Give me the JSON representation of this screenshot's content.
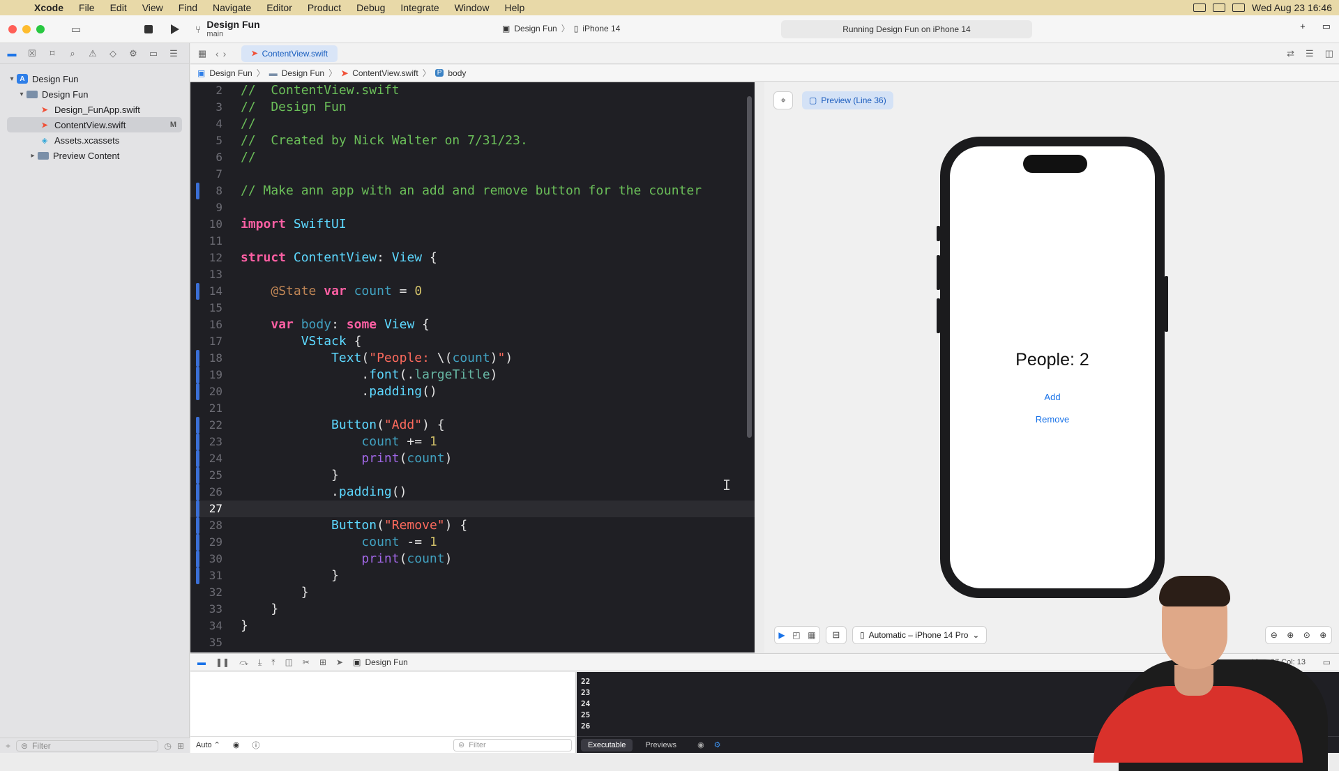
{
  "menubar": {
    "app_name": "Xcode",
    "menus": [
      "File",
      "Edit",
      "View",
      "Find",
      "Navigate",
      "Editor",
      "Product",
      "Debug",
      "Integrate",
      "Window",
      "Help"
    ],
    "datetime": "Wed Aug 23  16:46"
  },
  "toolbar": {
    "project_name": "Design Fun",
    "branch": "main",
    "scheme": "Design Fun",
    "destination": "iPhone 14",
    "status": "Running Design Fun on iPhone 14"
  },
  "navigator": {
    "items": [
      {
        "label": "Design Fun",
        "kind": "project",
        "level": 0
      },
      {
        "label": "Design Fun",
        "kind": "folder",
        "level": 1
      },
      {
        "label": "Design_FunApp.swift",
        "kind": "swift",
        "level": 2
      },
      {
        "label": "ContentView.swift",
        "kind": "swift",
        "level": 2,
        "badge": "M",
        "selected": true
      },
      {
        "label": "Assets.xcassets",
        "kind": "assets",
        "level": 2
      },
      {
        "label": "Preview Content",
        "kind": "folder",
        "level": 2
      }
    ],
    "filter_placeholder": "Filter"
  },
  "editor": {
    "tab": "ContentView.swift",
    "breadcrumbs": [
      "Design Fun",
      "Design Fun",
      "ContentView.swift",
      "body"
    ],
    "current_line": 27,
    "lines": [
      {
        "n": "2",
        "t": "//  ContentView.swift"
      },
      {
        "n": "3",
        "t": "//  Design Fun"
      },
      {
        "n": "4",
        "t": "//"
      },
      {
        "n": "5",
        "t": "//  Created by Nick Walter on 7/31/23."
      },
      {
        "n": "6",
        "t": "//"
      },
      {
        "n": "7",
        "t": ""
      },
      {
        "n": "8",
        "t": "// Make ann app with an add and remove button for the counter"
      },
      {
        "n": "9",
        "t": ""
      },
      {
        "n": "10",
        "t": "import SwiftUI"
      },
      {
        "n": "11",
        "t": ""
      },
      {
        "n": "12",
        "t": "struct ContentView: View {"
      },
      {
        "n": "13",
        "t": ""
      },
      {
        "n": "14",
        "t": "    @State var count = 0"
      },
      {
        "n": "15",
        "t": ""
      },
      {
        "n": "16",
        "t": "    var body: some View {"
      },
      {
        "n": "17",
        "t": "        VStack {"
      },
      {
        "n": "18",
        "t": "            Text(\"People: \\(count)\")"
      },
      {
        "n": "19",
        "t": "                .font(.largeTitle)"
      },
      {
        "n": "20",
        "t": "                .padding()"
      },
      {
        "n": "21",
        "t": ""
      },
      {
        "n": "22",
        "t": "            Button(\"Add\") {"
      },
      {
        "n": "23",
        "t": "                count += 1"
      },
      {
        "n": "24",
        "t": "                print(count)"
      },
      {
        "n": "25",
        "t": "            }"
      },
      {
        "n": "26",
        "t": "            .padding()"
      },
      {
        "n": "27",
        "t": ""
      },
      {
        "n": "28",
        "t": "            Button(\"Remove\") {"
      },
      {
        "n": "29",
        "t": "                count -= 1"
      },
      {
        "n": "30",
        "t": "                print(count)"
      },
      {
        "n": "31",
        "t": "            }"
      },
      {
        "n": "32",
        "t": "        }"
      },
      {
        "n": "33",
        "t": "    }"
      },
      {
        "n": "34",
        "t": "}"
      },
      {
        "n": "35",
        "t": ""
      }
    ]
  },
  "preview": {
    "label": "Preview (Line 36)",
    "people_text": "People: 2",
    "add_label": "Add",
    "remove_label": "Remove",
    "device": "Automatic – iPhone 14 Pro"
  },
  "debugbar": {
    "scheme": "Design Fun",
    "line_col": "Line: 27  Col: 13"
  },
  "debug_area": {
    "auto_label": "Auto ⌃",
    "filter_placeholder": "Filter",
    "console_output": [
      "22",
      "23",
      "24",
      "25",
      "26"
    ],
    "tabs": [
      "Executable",
      "Previews"
    ]
  }
}
